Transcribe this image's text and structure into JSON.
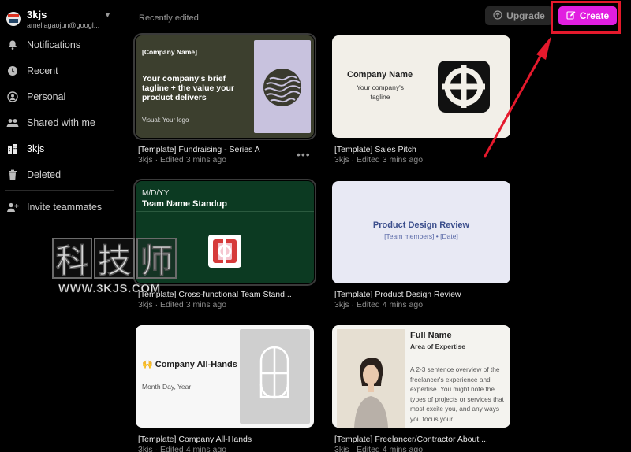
{
  "account": {
    "name": "3kjs",
    "email": "ameliagaojun@googl..."
  },
  "sidebar": {
    "items": [
      {
        "label": "Notifications",
        "icon": "bell-icon"
      },
      {
        "label": "Recent",
        "icon": "clock-icon"
      },
      {
        "label": "Personal",
        "icon": "person-icon"
      },
      {
        "label": "Shared with me",
        "icon": "people-icon"
      },
      {
        "label": "3kjs",
        "icon": "building-icon"
      },
      {
        "label": "Deleted",
        "icon": "trash-icon"
      }
    ],
    "invite": {
      "label": "Invite teammates",
      "icon": "add-user-icon"
    }
  },
  "main": {
    "section_title": "Recently edited",
    "upgrade_label": "Upgrade",
    "create_label": "Create",
    "more_label": "•••"
  },
  "cards": [
    {
      "title": "[Template] Fundraising - Series A",
      "meta": "3kjs · Edited 3 mins ago",
      "thumb": {
        "kicker": "[Company Name]",
        "headline": "Your company's brief tagline + the value your product delivers",
        "footer": "Visual: Your logo"
      }
    },
    {
      "title": "[Template] Sales Pitch",
      "meta": "3kjs · Edited 3 mins ago",
      "thumb": {
        "headline": "Company Name",
        "sub": "Your company's tagline"
      }
    },
    {
      "title": "[Template] Cross-functional Team Stand...",
      "meta": "3kjs · Edited 3 mins ago",
      "thumb": {
        "kicker": "M/D/YY",
        "headline": "Team Name Standup"
      }
    },
    {
      "title": "[Template] Product Design Review",
      "meta": "3kjs · Edited 4 mins ago",
      "thumb": {
        "headline": "Product Design Review",
        "sub": "[Team members] • [Date]"
      }
    },
    {
      "title": "[Template] Company All-Hands",
      "meta": "3kjs · Edited 4 mins ago",
      "thumb": {
        "headline": "🙌 Company All-Hands",
        "sub": "Month Day, Year"
      }
    },
    {
      "title": "[Template] Freelancer/Contractor About ...",
      "meta": "3kjs · Edited 4 mins ago",
      "thumb": {
        "headline": "Full Name",
        "sub": "Area of Expertise",
        "body": "A 2-3 sentence overview of the freelancer's experience and expertise. You might note the types of projects or services that most excite you, and any ways you focus your"
      }
    }
  ],
  "watermark": {
    "chars": [
      "科",
      "技",
      "师"
    ],
    "url": "WWW.3KJS.COM"
  },
  "colors": {
    "accent": "#e11ee0",
    "annotation": "#e5192c",
    "background": "#000000"
  }
}
